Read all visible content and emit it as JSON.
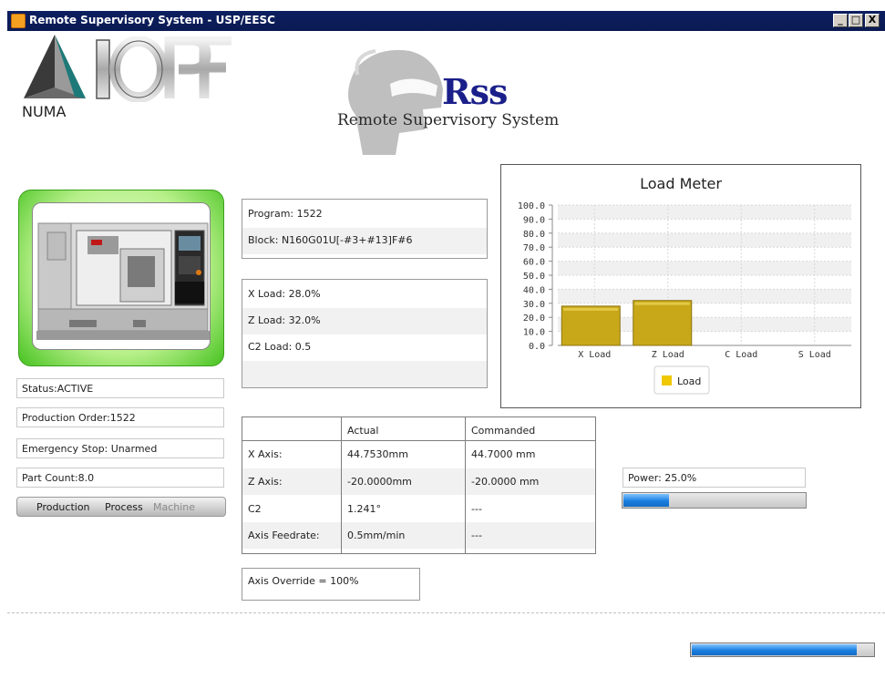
{
  "window": {
    "title": "Remote Supervisory System - USP/EESC",
    "buttons": [
      "_",
      "□",
      "X"
    ]
  },
  "logos": {
    "numa": "NUMA",
    "iopf": "IOPF",
    "rss_title": "Rss",
    "rss_subtitle": "Remote Supervisory System"
  },
  "status": {
    "status": "Status:ACTIVE",
    "production_order": "Production Order:1522",
    "emergency_stop": "Emergency Stop: Unarmed",
    "part_count": "Part Count:8.0"
  },
  "tabs": [
    {
      "label": "Production",
      "active": true
    },
    {
      "label": "Process",
      "active": true
    },
    {
      "label": "Machine",
      "active": false
    }
  ],
  "program": {
    "program": "Program: 1522",
    "block": "Block: N160G01U[-#3+#13]F#6"
  },
  "loads": {
    "x_load": "X Load: 28.0%",
    "z_load": "Z Load: 32.0%",
    "c2_load": "C2 Load: 0.5"
  },
  "axis_table": {
    "headers": [
      "",
      "Actual",
      "Commanded"
    ],
    "rows": [
      [
        "X Axis:",
        "44.7530mm",
        "44.7000 mm"
      ],
      [
        "Z Axis:",
        "-20.0000mm",
        "-20.0000 mm"
      ],
      [
        "C2",
        "1.241°",
        "---"
      ],
      [
        "Axis Feedrate:",
        "0.5mm/min",
        "---"
      ]
    ]
  },
  "override": "Axis Override = 100%",
  "power": {
    "label": "Power: 25.0%",
    "value": 0.25
  },
  "bottom_progress": {
    "value": 0.9
  },
  "colors": {
    "bar": "#c8a818",
    "accent_blue": "#1a7ee0",
    "title_bar": "#0c1f60"
  },
  "chart_data": {
    "type": "bar",
    "title": "Load Meter",
    "categories": [
      "X Load",
      "Z Load",
      "C Load",
      "S Load"
    ],
    "series": [
      {
        "name": "Load",
        "values": [
          28.0,
          32.0,
          0,
          0
        ]
      }
    ],
    "ylim": [
      0,
      100
    ],
    "yticks": [
      "0.0",
      "10.0",
      "20.0",
      "30.0",
      "40.0",
      "50.0",
      "60.0",
      "70.0",
      "80.0",
      "90.0",
      "100.0"
    ],
    "grid": true,
    "legend": "bottom"
  }
}
